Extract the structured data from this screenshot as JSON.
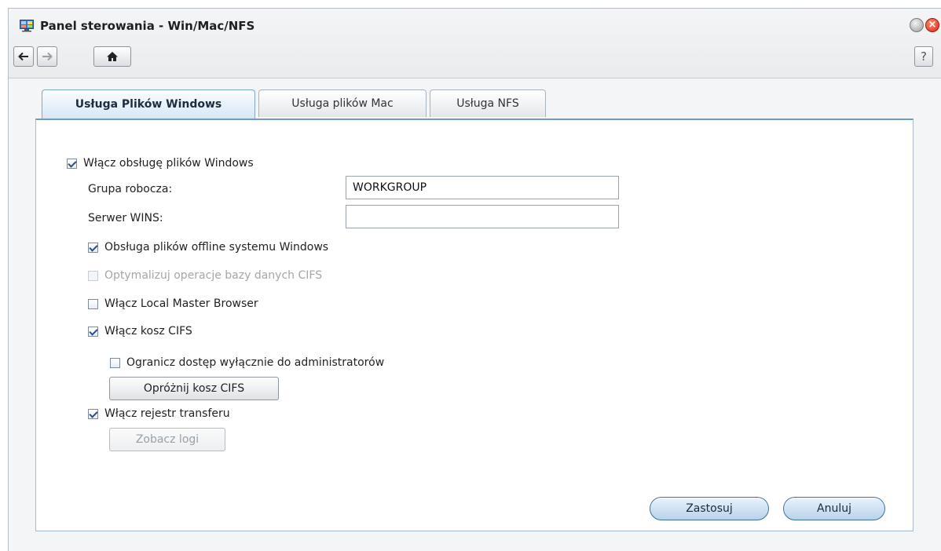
{
  "window": {
    "title": "Panel sterowania - Win/Mac/NFS",
    "help_label": "?"
  },
  "tabs": [
    {
      "label": "Usługa Plików Windows",
      "active": true
    },
    {
      "label": "Usługa plików Mac",
      "active": false
    },
    {
      "label": "Usługa NFS",
      "active": false
    }
  ],
  "form": {
    "enable_windows": {
      "label": "Włącz obsługę plików Windows",
      "checked": true
    },
    "workgroup": {
      "label": "Grupa robocza:",
      "value": "WORKGROUP"
    },
    "wins": {
      "label": "Serwer WINS:",
      "value": ""
    },
    "offline_files": {
      "label": "Obsługa plików offline systemu Windows",
      "checked": true
    },
    "optimize_cifs": {
      "label": "Optymalizuj operacje bazy danych CIFS",
      "checked": false,
      "disabled": true
    },
    "local_master": {
      "label": "Włącz Local Master Browser",
      "checked": false
    },
    "cifs_recycle": {
      "label": "Włącz kosz CIFS",
      "checked": true
    },
    "restrict_admin": {
      "label": "Ogranicz dostęp wyłącznie do administratorów",
      "checked": false
    },
    "empty_recycle_button": "Opróżnij kosz CIFS",
    "transfer_log": {
      "label": "Włącz rejestr transferu",
      "checked": true
    },
    "view_logs_button": "Zobacz logi"
  },
  "actions": {
    "apply": "Zastosuj",
    "cancel": "Anuluj"
  },
  "colors": {
    "accent": "#6d9bc3",
    "close": "#d7261a"
  }
}
